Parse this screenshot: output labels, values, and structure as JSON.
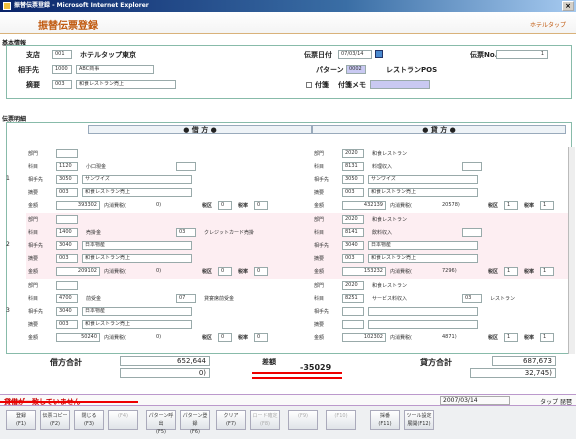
{
  "window": {
    "title": "振替伝票登録 - Microsoft Internet Explorer"
  },
  "header": {
    "title": "振替伝票登録",
    "right": "ホテルタップ"
  },
  "basic": {
    "section": "基本情報",
    "branch_label": "支店",
    "branch_code": "001",
    "branch_name": "ホテルタップ東京",
    "partner_label": "相手先",
    "partner_code": "1000",
    "partner_name": "ABC商事",
    "summary_label": "摘要",
    "summary_code": "003",
    "summary_text": "和食レストラン売上",
    "date_label": "伝票日付",
    "date_value": "07/03/14",
    "slip_label": "伝票No.",
    "slip_value": "1",
    "pattern_label": "パターン",
    "pattern_code": "0002",
    "pattern_name": "レストランPOS",
    "sticky_label": "付箋",
    "sticky_memo_label": "付箋メモ"
  },
  "detail": {
    "section": "伝票明細",
    "debit_header": "● 借 方 ●",
    "credit_header": "● 貸 方 ●",
    "row_labels": {
      "dept": "部門",
      "account": "科目",
      "partner": "相手先",
      "summary": "摘要",
      "amount": "金額"
    },
    "tax_label": "内消費税(",
    "tax_cat": "税区",
    "tax_rate": "税率",
    "vouchers": [
      {
        "num": "1",
        "debit": {
          "dept": "",
          "acct_code": "1120",
          "acct_name": "小口現金",
          "sub": "",
          "partner_code": "3050",
          "partner_name": "サンワイズ",
          "summary_code": "003",
          "summary_text": "和食レストラン売上",
          "amount": "393302",
          "tax": "0)",
          "taxcat": "0",
          "rate": "0"
        },
        "credit": {
          "dept": "2020",
          "dept_name": "和食レストラン",
          "acct_code": "8131",
          "acct_name": "料理収入",
          "partner_code": "3050",
          "partner_name": "サンワイズ",
          "summary_code": "003",
          "summary_text": "和食レストラン売上",
          "amount": "432139",
          "tax": "20578)",
          "taxcat": "1",
          "rate": "1"
        }
      },
      {
        "num": "2",
        "debit": {
          "dept": "",
          "acct_code": "1400",
          "acct_name": "売掛金",
          "sub": "03",
          "sub_name": "クレジットカード売掛",
          "partner_code": "3040",
          "partner_name": "日本物産",
          "summary_code": "003",
          "summary_text": "和食レストラン売上",
          "amount": "209102",
          "tax": "0)",
          "taxcat": "0",
          "rate": "0"
        },
        "credit": {
          "dept": "2020",
          "dept_name": "和食レストラン",
          "acct_code": "8141",
          "acct_name": "飲料収入",
          "partner_code": "3040",
          "partner_name": "日本物産",
          "summary_code": "003",
          "summary_text": "和食レストラン売上",
          "amount": "153232",
          "tax": "7296)",
          "taxcat": "1",
          "rate": "1"
        }
      },
      {
        "num": "3",
        "debit": {
          "dept": "",
          "acct_code": "4700",
          "acct_name": "前受金",
          "sub": "07",
          "sub_name": "貸宴席前受金",
          "partner_code": "3040",
          "partner_name": "日本物産",
          "summary_code": "003",
          "summary_text": "和食レストラン売上",
          "amount": "50240",
          "tax": "0)",
          "taxcat": "0",
          "rate": "0"
        },
        "credit": {
          "dept": "2020",
          "dept_name": "和食レストラン",
          "acct_code": "8251",
          "acct_name": "サービス料収入",
          "sub": "03",
          "sub_name": "レストラン",
          "partner_code": "",
          "partner_name": "",
          "summary_code": "",
          "summary_text": "",
          "amount": "102302",
          "tax": "4871)",
          "taxcat": "1",
          "rate": "1"
        }
      }
    ]
  },
  "totals": {
    "debit_label": "借方合計",
    "debit_total": "652,644",
    "debit_tax": "0)",
    "diff_label": "差額",
    "diff_value": "-35029",
    "credit_label": "貸方合計",
    "credit_total": "687,673",
    "credit_tax": "32,745)"
  },
  "status": {
    "message": "貸借が一致していません",
    "date": "2007/03/14",
    "user": "タップ 琵琶"
  },
  "fkeys": [
    {
      "label": "登録",
      "key": "(F1)",
      "enabled": true
    },
    {
      "label": "伝票コピー",
      "key": "(F2)",
      "enabled": true
    },
    {
      "label": "閉じる",
      "key": "(F3)",
      "enabled": true
    },
    {
      "label": "",
      "key": "(F4)",
      "enabled": false
    },
    {
      "label": "パターン呼出",
      "key": "(F5)",
      "enabled": true
    },
    {
      "label": "パターン登録",
      "key": "(F6)",
      "enabled": true
    },
    {
      "label": "クリア",
      "key": "(F7)",
      "enabled": true
    },
    {
      "label": "ロード確定",
      "key": "(F8)",
      "enabled": false
    },
    {
      "label": "",
      "key": "(F9)",
      "enabled": false
    },
    {
      "label": "",
      "key": "(F10)",
      "enabled": false
    },
    {
      "label": "採番",
      "key": "(F11)",
      "enabled": true
    },
    {
      "label": "ツール設定",
      "key": "展開(F12)",
      "enabled": true
    }
  ],
  "colors": {
    "accent": "#c05a10",
    "error": "#cc0000",
    "alt_row": "#fdeef2"
  }
}
